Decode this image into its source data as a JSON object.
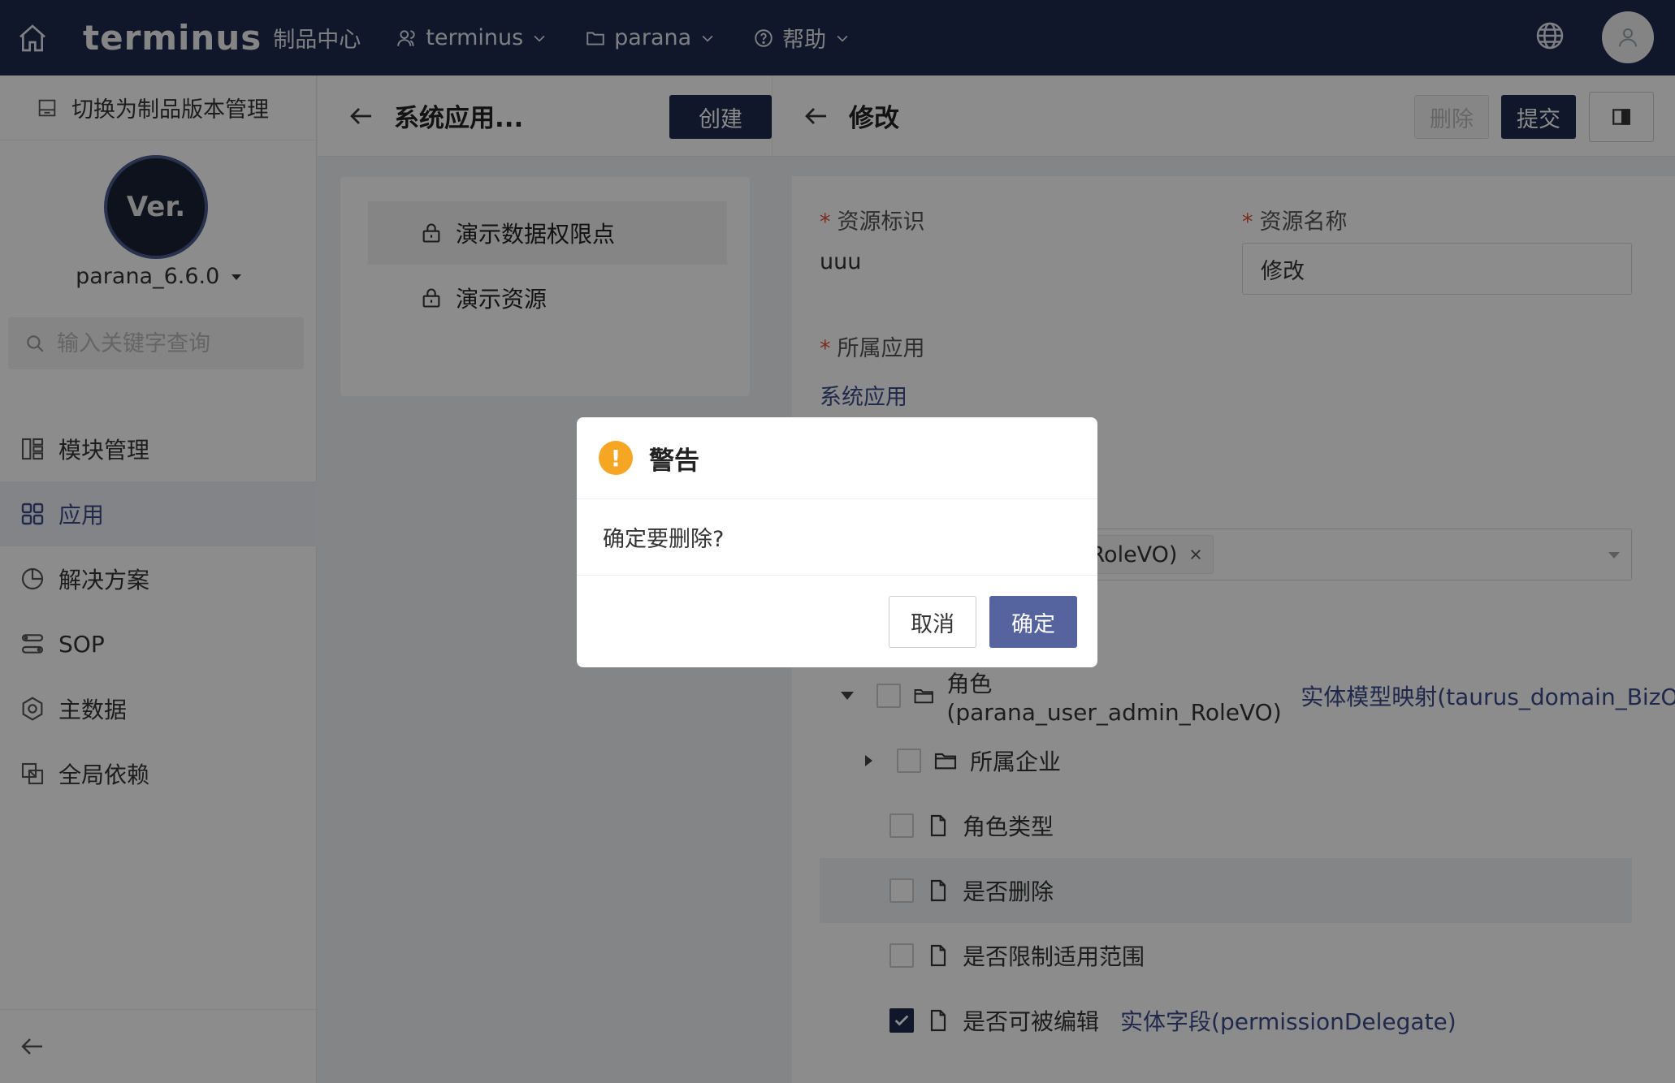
{
  "topbar": {
    "logo": "terminus",
    "logo_sub": "制品中心",
    "menus": [
      {
        "label": "terminus",
        "icon": "user-icon"
      },
      {
        "label": "parana",
        "icon": "folder-icon"
      },
      {
        "label": "帮助",
        "icon": "help-circle-icon"
      }
    ]
  },
  "sidebar": {
    "switch_label": "切换为制品版本管理",
    "logo_text": "Ver.",
    "version": "parana_6.6.0",
    "search_placeholder": "输入关键字查询",
    "items": [
      {
        "label": "模块管理",
        "icon": "module-icon"
      },
      {
        "label": "应用",
        "icon": "app-grid-icon"
      },
      {
        "label": "解决方案",
        "icon": "solution-icon"
      },
      {
        "label": "SOP",
        "icon": "sop-icon"
      },
      {
        "label": "主数据",
        "icon": "master-data-icon"
      },
      {
        "label": "全局依赖",
        "icon": "dependency-icon"
      }
    ],
    "active_item": "应用"
  },
  "middle": {
    "title": "系统应用...",
    "create_label": "创建",
    "tree": [
      {
        "label": "演示数据权限点",
        "icon": "lock-icon"
      },
      {
        "label": "演示资源",
        "icon": "lock-icon"
      }
    ]
  },
  "right": {
    "title": "修改",
    "delete_label": "删除",
    "submit_label": "提交",
    "form": {
      "resource_key_label": "资源标识",
      "resource_key_value": "uuu",
      "resource_name_label": "资源名称",
      "resource_name_value": "修改",
      "app_label": "所属应用",
      "app_value": "系统应用",
      "tag_value": "_RoleVO)"
    },
    "tree": {
      "root_label": "角色(parana_user_admin_RoleVO)",
      "root_link": "实体模型映射(taurus_domain_BizOb",
      "children": [
        {
          "label": "所属企业",
          "type": "folder"
        },
        {
          "label": "角色类型",
          "type": "file"
        },
        {
          "label": "是否删除",
          "type": "file"
        },
        {
          "label": "是否限制适用范围",
          "type": "file"
        },
        {
          "label": "是否可被编辑",
          "type": "file",
          "checked": true,
          "link": "实体字段(permissionDelegate)"
        }
      ]
    }
  },
  "modal": {
    "title": "警告",
    "message": "确定要删除?",
    "cancel_label": "取消",
    "ok_label": "确定"
  }
}
